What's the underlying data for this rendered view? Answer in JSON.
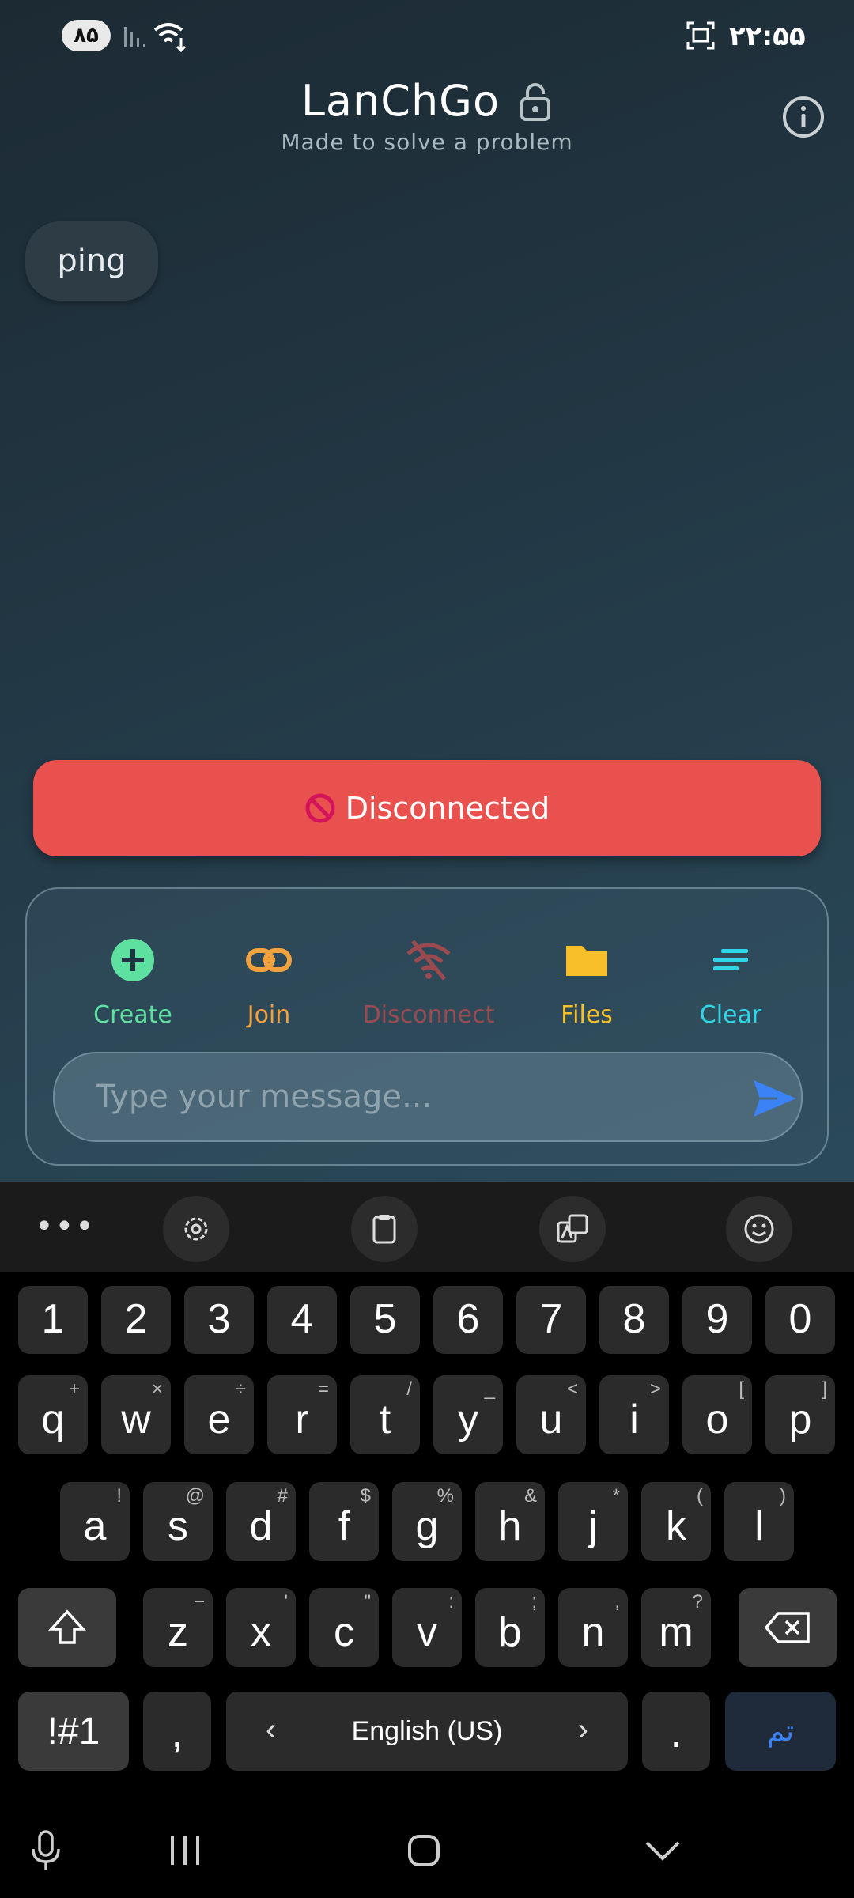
{
  "status_bar": {
    "battery": "۸۵",
    "time": "۲۲:۵۵"
  },
  "header": {
    "title": "LanChGo",
    "subtitle": "Made to solve a problem"
  },
  "messages": [
    {
      "text": "ping"
    }
  ],
  "connection": {
    "status_text": "Disconnected",
    "status_color": "#e9514f"
  },
  "actions": [
    {
      "label": "Create",
      "color": "#5ee0a0",
      "icon": "plus-circle-icon"
    },
    {
      "label": "Join",
      "color": "#f2a23c",
      "icon": "link-icon"
    },
    {
      "label": "Disconnect",
      "color": "#9b4b50",
      "icon": "wifi-off-icon"
    },
    {
      "label": "Files",
      "color": "#f7c02a",
      "icon": "folder-icon"
    },
    {
      "label": "Clear",
      "color": "#2fd6e8",
      "icon": "clear-lines-icon"
    }
  ],
  "composer": {
    "placeholder": "Type your message..."
  },
  "keyboard": {
    "numbers": [
      "1",
      "2",
      "3",
      "4",
      "5",
      "6",
      "7",
      "8",
      "9",
      "0"
    ],
    "row1": [
      [
        "q",
        "+"
      ],
      [
        "w",
        "×"
      ],
      [
        "e",
        "÷"
      ],
      [
        "r",
        "="
      ],
      [
        "t",
        "/"
      ],
      [
        "y",
        "_"
      ],
      [
        "u",
        "<"
      ],
      [
        "i",
        ">"
      ],
      [
        "o",
        "["
      ],
      [
        "p",
        "]"
      ]
    ],
    "row2": [
      [
        "a",
        "!"
      ],
      [
        "s",
        "@"
      ],
      [
        "d",
        "#"
      ],
      [
        "f",
        "$"
      ],
      [
        "g",
        "%"
      ],
      [
        "h",
        "&"
      ],
      [
        "j",
        "*"
      ],
      [
        "k",
        "("
      ],
      [
        "l",
        ")"
      ]
    ],
    "row3": [
      [
        "z",
        "−"
      ],
      [
        "x",
        "'"
      ],
      [
        "c",
        "\""
      ],
      [
        "v",
        ":"
      ],
      [
        "b",
        ";"
      ],
      [
        "n",
        ","
      ],
      [
        "m",
        "?"
      ]
    ],
    "symbols_label": "!#1",
    "comma": ",",
    "language": "English (US)",
    "period": ".",
    "done_label": "تم"
  }
}
